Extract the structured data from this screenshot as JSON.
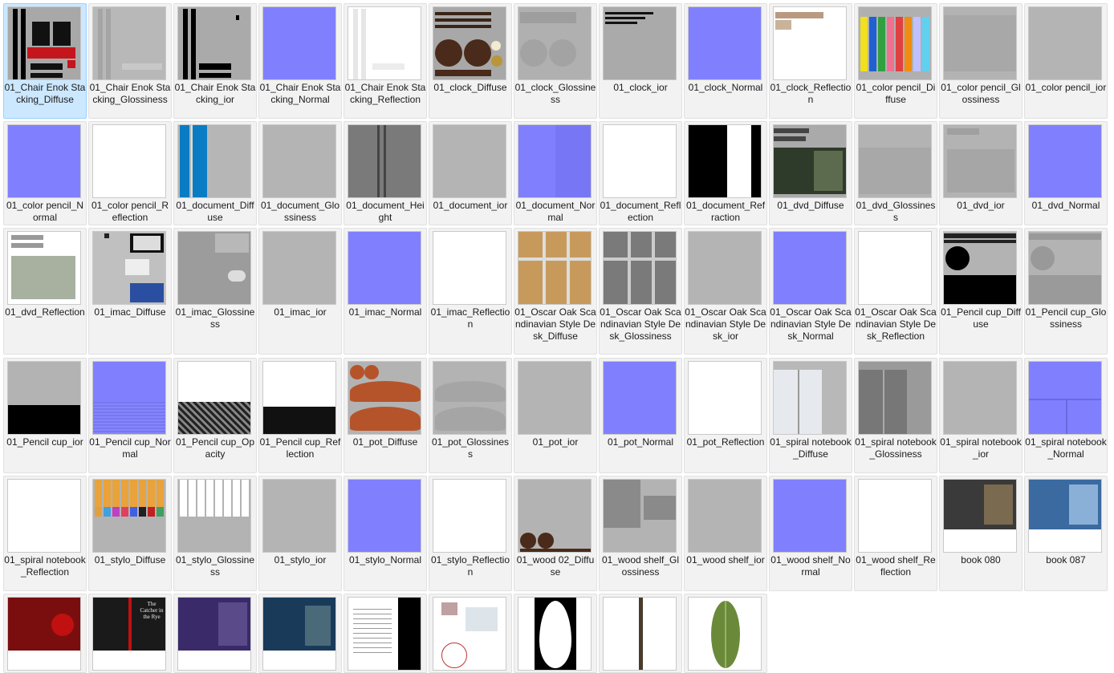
{
  "explorer": {
    "files": [
      {
        "name": "01_Chair Enok Stacking_Diffuse",
        "thumb": "chair-diffuse",
        "selected": true
      },
      {
        "name": "01_Chair Enok Stacking_Glossiness",
        "thumb": "chair-gloss"
      },
      {
        "name": "01_Chair Enok Stacking_ior",
        "thumb": "chair-ior"
      },
      {
        "name": "01_Chair Enok Stacking_Normal",
        "thumb": "normal"
      },
      {
        "name": "01_Chair Enok Stacking_Reflection",
        "thumb": "chair-refl"
      },
      {
        "name": "01_clock_Diffuse",
        "thumb": "clock-diffuse"
      },
      {
        "name": "01_clock_Glossiness",
        "thumb": "clock-gloss"
      },
      {
        "name": "01_clock_ior",
        "thumb": "clock-ior"
      },
      {
        "name": "01_clock_Normal",
        "thumb": "normal"
      },
      {
        "name": "01_clock_Reflection",
        "thumb": "clock-refl"
      },
      {
        "name": "01_color pencil_Diffuse",
        "thumb": "pencil-diffuse"
      },
      {
        "name": "01_color pencil_Glossiness",
        "thumb": "pencil-gloss"
      },
      {
        "name": "01_color pencil_ior",
        "thumb": "gray"
      },
      {
        "name": "01_color pencil_Normal",
        "thumb": "normal"
      },
      {
        "name": "01_color pencil_Reflection",
        "thumb": "white"
      },
      {
        "name": "01_document_Diffuse",
        "thumb": "doc-diffuse"
      },
      {
        "name": "01_document_Glossiness",
        "thumb": "gray"
      },
      {
        "name": "01_document_Height",
        "thumb": "doc-height"
      },
      {
        "name": "01_document_ior",
        "thumb": "gray"
      },
      {
        "name": "01_document_Normal",
        "thumb": "doc-normal"
      },
      {
        "name": "01_document_Reflection",
        "thumb": "white"
      },
      {
        "name": "01_document_Refraction",
        "thumb": "doc-refr"
      },
      {
        "name": "01_dvd_Diffuse",
        "thumb": "dvd-diffuse"
      },
      {
        "name": "01_dvd_Glossiness",
        "thumb": "dvd-gloss"
      },
      {
        "name": "01_dvd_ior",
        "thumb": "dvd-ior"
      },
      {
        "name": "01_dvd_Normal",
        "thumb": "normal"
      },
      {
        "name": "01_dvd_Reflection",
        "thumb": "dvd-refl"
      },
      {
        "name": "01_imac_Diffuse",
        "thumb": "imac-diffuse"
      },
      {
        "name": "01_imac_Glossiness",
        "thumb": "imac-gloss"
      },
      {
        "name": "01_imac_ior",
        "thumb": "gray"
      },
      {
        "name": "01_imac_Normal",
        "thumb": "normal"
      },
      {
        "name": "01_imac_Reflection",
        "thumb": "white"
      },
      {
        "name": "01_Oscar Oak Scandinavian Style Desk_Diffuse",
        "thumb": "oak-diffuse"
      },
      {
        "name": "01_Oscar Oak Scandinavian Style Desk_Glossiness",
        "thumb": "oak-gloss"
      },
      {
        "name": "01_Oscar Oak Scandinavian Style Desk_ior",
        "thumb": "gray"
      },
      {
        "name": "01_Oscar Oak Scandinavian Style Desk_Normal",
        "thumb": "normal"
      },
      {
        "name": "01_Oscar Oak Scandinavian Style Desk_Reflection",
        "thumb": "white"
      },
      {
        "name": "01_Pencil cup_Diffuse",
        "thumb": "cup-diffuse"
      },
      {
        "name": "01_Pencil cup_Glossiness",
        "thumb": "cup-gloss"
      },
      {
        "name": "01_Pencil cup_ior",
        "thumb": "cup-ior"
      },
      {
        "name": "01_Pencil cup_Normal",
        "thumb": "cup-normal"
      },
      {
        "name": "01_Pencil cup_Opacity",
        "thumb": "cup-opacity"
      },
      {
        "name": "01_Pencil cup_Reflection",
        "thumb": "cup-refl"
      },
      {
        "name": "01_pot_Diffuse",
        "thumb": "pot-diffuse"
      },
      {
        "name": "01_pot_Glossiness",
        "thumb": "pot-gloss"
      },
      {
        "name": "01_pot_ior",
        "thumb": "gray"
      },
      {
        "name": "01_pot_Normal",
        "thumb": "normal"
      },
      {
        "name": "01_pot_Reflection",
        "thumb": "white"
      },
      {
        "name": "01_spiral notebook_Diffuse",
        "thumb": "nb-diffuse"
      },
      {
        "name": "01_spiral notebook_Glossiness",
        "thumb": "nb-gloss"
      },
      {
        "name": "01_spiral notebook_ior",
        "thumb": "gray"
      },
      {
        "name": "01_spiral notebook_Normal",
        "thumb": "nb-normal"
      },
      {
        "name": "01_spiral notebook_Reflection",
        "thumb": "white"
      },
      {
        "name": "01_stylo_Diffuse",
        "thumb": "stylo-diffuse"
      },
      {
        "name": "01_stylo_Glossiness",
        "thumb": "stylo-gloss"
      },
      {
        "name": "01_stylo_ior",
        "thumb": "gray"
      },
      {
        "name": "01_stylo_Normal",
        "thumb": "normal"
      },
      {
        "name": "01_stylo_Reflection",
        "thumb": "white"
      },
      {
        "name": "01_wood 02_Diffuse",
        "thumb": "wood-diffuse"
      },
      {
        "name": "01_wood shelf_Glossiness",
        "thumb": "shelf-gloss"
      },
      {
        "name": "01_wood shelf_ior",
        "thumb": "gray"
      },
      {
        "name": "01_wood shelf_Normal",
        "thumb": "normal"
      },
      {
        "name": "01_wood shelf_Reflection",
        "thumb": "white"
      },
      {
        "name": "book 080",
        "thumb": "book080"
      },
      {
        "name": "book 087",
        "thumb": "book087"
      },
      {
        "name": "",
        "thumb": "book-red"
      },
      {
        "name": "",
        "thumb": "book-catcher"
      },
      {
        "name": "",
        "thumb": "book-purple"
      },
      {
        "name": "",
        "thumb": "book-blue"
      },
      {
        "name": "",
        "thumb": "letter"
      },
      {
        "name": "",
        "thumb": "brochure"
      },
      {
        "name": "",
        "thumb": "leaf-mask"
      },
      {
        "name": "",
        "thumb": "stick"
      },
      {
        "name": "",
        "thumb": "leaf"
      }
    ],
    "thumbnail_text": {
      "book_catcher_title": "The Catcher in the Rye"
    }
  }
}
